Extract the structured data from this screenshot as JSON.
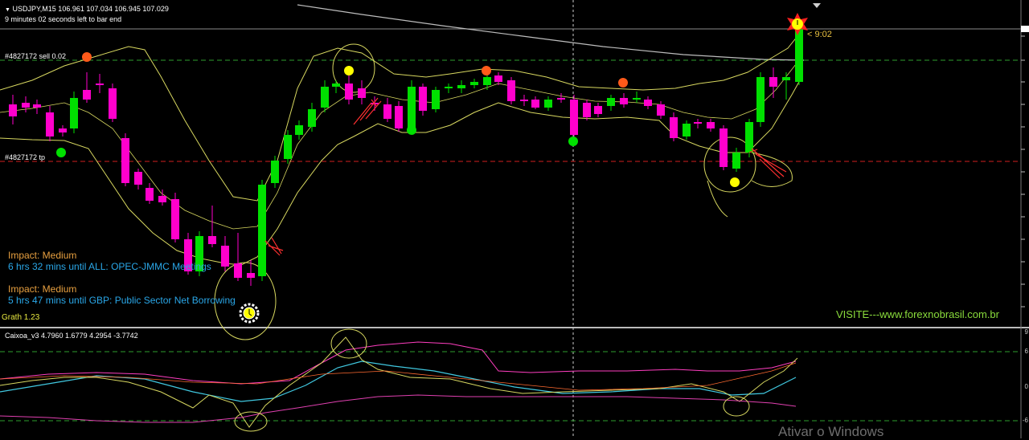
{
  "header": {
    "symbol_line": "USDJPY,M15  106.961 107.034 106.945 107.029",
    "countdown": "9 minutes 02 seconds left to bar end"
  },
  "orders": {
    "sell_label": "#4827172 sell 0.02",
    "tp_label": "#4827172 tp"
  },
  "timer_label": "< 9:02",
  "news": [
    {
      "impact": "Impact: Medium",
      "event": "6 hrs 32 mins until ALL: OPEC-JMMC Meetings"
    },
    {
      "impact": "Impact: Medium",
      "event": "5 hrs 47 mins until GBP: Public Sector Net Borrowing"
    }
  ],
  "grath_label": "Grath 1.23",
  "visit_label": "VISITE---www.forexnobrasil.com.br",
  "indicator_label": "Caixoa_v3 4.7960 1.6779 4.2954 -3.7742",
  "indicator_scale": [
    "9",
    "6",
    "0",
    "-6"
  ],
  "watermark": "Ativar o Windows",
  "colors": {
    "bull": "#00e000",
    "bear": "#ff00cc",
    "bands": "#d8d860",
    "sell_line": "#2e9e2e",
    "tp_line": "#d02020",
    "marker_orange": "#ff5a1a",
    "marker_yellow": "#ffff00",
    "marker_green": "#00e000"
  }
}
